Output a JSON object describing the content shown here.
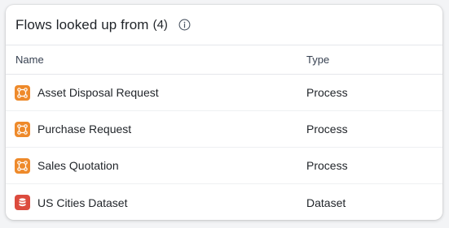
{
  "header": {
    "title": "Flows looked up from",
    "count": "(4)",
    "info_icon": "info-icon"
  },
  "table": {
    "columns": [
      "Name",
      "Type"
    ],
    "rows": [
      {
        "name": "Asset Disposal Request",
        "type": "Process",
        "icon": "process-icon",
        "color": "#ee8a2b"
      },
      {
        "name": "Purchase Request",
        "type": "Process",
        "icon": "process-icon",
        "color": "#ee8a2b"
      },
      {
        "name": "Sales Quotation",
        "type": "Process",
        "icon": "process-icon",
        "color": "#ee8a2b"
      },
      {
        "name": "US Cities Dataset",
        "type": "Dataset",
        "icon": "dataset-icon",
        "color": "#dc4b3e"
      }
    ]
  },
  "colors": {
    "process": "#ee8a2b",
    "dataset": "#dc4b3e",
    "border": "#e5e7eb"
  }
}
